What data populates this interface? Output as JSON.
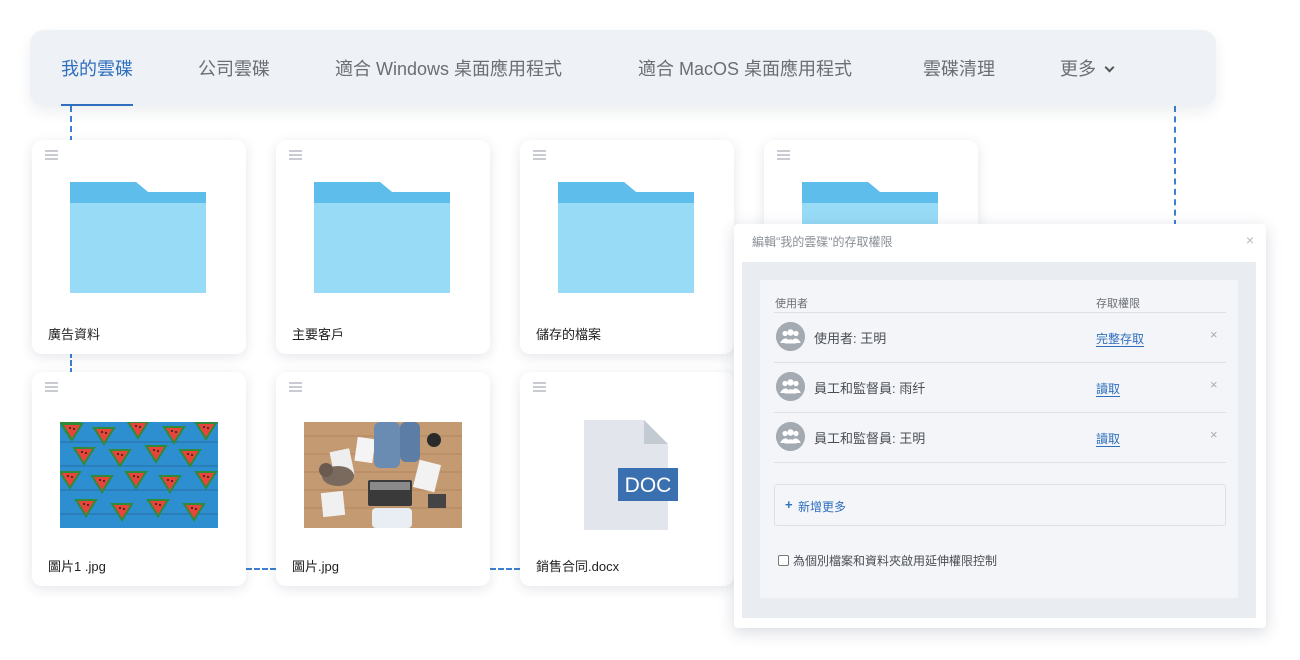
{
  "tabs": [
    {
      "label": "我的雲碟",
      "active": true
    },
    {
      "label": "公司雲碟",
      "active": false
    },
    {
      "label": "適合 Windows 桌面應用程式",
      "active": false
    },
    {
      "label": "適合 MacOS 桌面應用程式",
      "active": false
    },
    {
      "label": "雲碟清理",
      "active": false
    },
    {
      "label": "更多",
      "active": false,
      "icon": "chevron-down-icon"
    }
  ],
  "items": [
    {
      "name": "廣告資料",
      "type": "folder"
    },
    {
      "name": "主要客戶",
      "type": "folder"
    },
    {
      "name": "儲存的檔案",
      "type": "folder"
    },
    {
      "name": "",
      "type": "folder"
    },
    {
      "name": "圖片1 .jpg",
      "type": "image"
    },
    {
      "name": "圖片.jpg",
      "type": "image"
    },
    {
      "name": "銷售合同.docx",
      "type": "document",
      "badge": "DOC"
    }
  ],
  "dialog": {
    "title": "編輯\"我的雲碟\"的存取權限",
    "close_icon": "close-icon",
    "columns": {
      "user": "使用者",
      "access": "存取權限"
    },
    "rows": [
      {
        "name": "使用者: 王明",
        "access": "完整存取",
        "icon": "user-group-icon"
      },
      {
        "name": "員工和監督員: 雨纤",
        "access": "讀取",
        "icon": "user-group-icon"
      },
      {
        "name": "員工和監督員: 王明",
        "access": "讀取",
        "icon": "user-group-icon"
      }
    ],
    "remove_symbol": "×",
    "add_more": "新增更多",
    "extended_permissions": {
      "label": "為個別檔案和資料夾啟用延伸權限控制",
      "checked": false
    }
  },
  "colors": {
    "accent": "#2f6fbe",
    "folder_light": "#97dbf7",
    "folder_dark": "#5ebdeb",
    "doc_badge": "#3a6fb0",
    "connector": "#3d7fd0"
  }
}
